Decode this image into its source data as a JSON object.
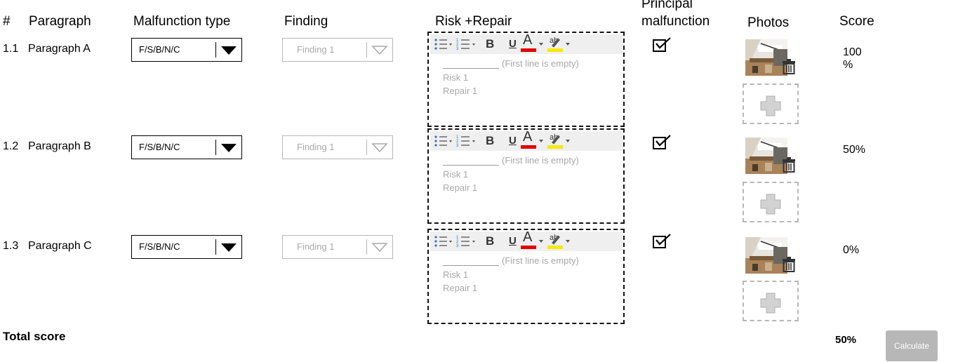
{
  "headers": {
    "num": "#",
    "paragraph": "Paragraph",
    "malfunction_type": "Malfunction type",
    "finding": "Finding",
    "risk_repair": "Risk +Repair",
    "principal_line1": "Principal",
    "principal_line2": "malfunction",
    "photos": "Photos",
    "score": "Score"
  },
  "rows": [
    {
      "num": "1.1",
      "paragraph": "Paragraph A",
      "malfunction_value": "F/S/B/N/C",
      "finding_value": "Finding 1",
      "editor_first_line": "(First line is empty)",
      "editor_risk": "Risk 1",
      "editor_repair": "Repair 1",
      "principal_checked": true,
      "score_line1": "100",
      "score_line2": "%"
    },
    {
      "num": "1.2",
      "paragraph": "Paragraph B",
      "malfunction_value": "F/S/B/N/C",
      "finding_value": "Finding 1",
      "editor_first_line": "(First line is empty)",
      "editor_risk": "Risk 1",
      "editor_repair": "Repair 1",
      "principal_checked": true,
      "score_line1": "50%",
      "score_line2": ""
    },
    {
      "num": "1.3",
      "paragraph": "Paragraph C",
      "malfunction_value": "F/S/B/N/C",
      "finding_value": "Finding 1",
      "editor_first_line": "(First line is empty)",
      "editor_risk": "Risk 1",
      "editor_repair": "Repair 1",
      "principal_checked": true,
      "score_line1": "0%",
      "score_line2": ""
    }
  ],
  "toolbar": {
    "bold_label": "B",
    "underline_label": "U",
    "font_color_label": "A",
    "highlight_label": "ab",
    "font_color": "#e00000",
    "highlight_color": "#f5ea00"
  },
  "icons": [
    "bullet-list-icon",
    "numbered-list-icon",
    "bold-icon",
    "underline-icon",
    "font-color-icon",
    "highlight-icon",
    "dropdown-arrow-icon",
    "checkbox-checked-icon",
    "trash-icon",
    "add-photo-icon"
  ],
  "footer": {
    "total_label": "Total score",
    "total_value": "50%",
    "calculate_label": "Calculate"
  }
}
